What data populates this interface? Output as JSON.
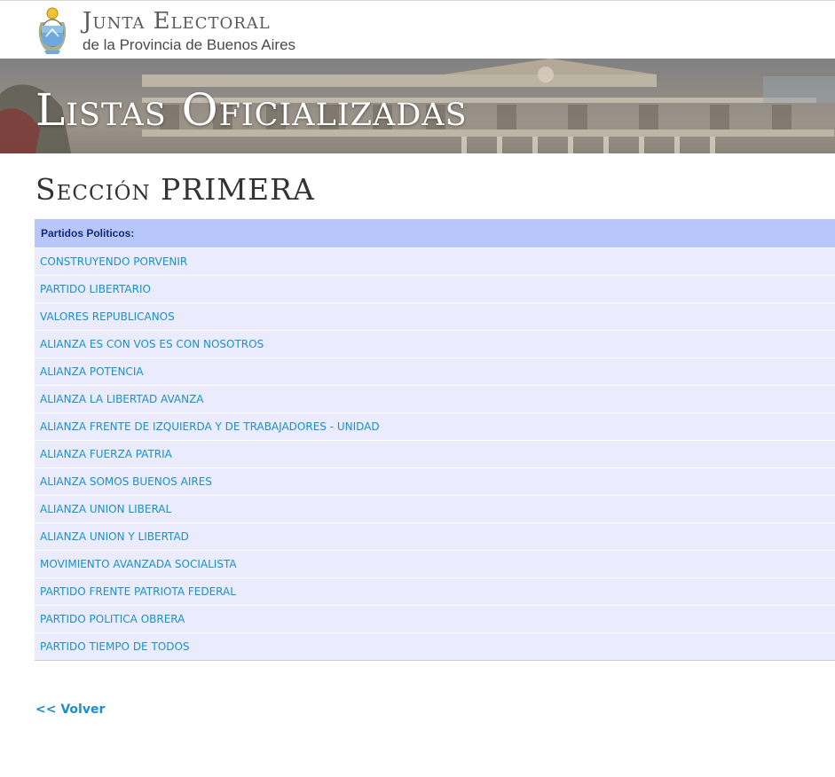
{
  "header": {
    "brand_title": "Junta Electoral",
    "brand_subtitle": "de la Provincia de Buenos Aires"
  },
  "banner": {
    "title": "Listas Oficializadas"
  },
  "section": {
    "title": "Sección PRIMERA"
  },
  "table": {
    "header": "Partidos Politicos:",
    "parties": [
      "CONSTRUYENDO PORVENIR",
      "PARTIDO LIBERTARIO",
      "VALORES REPUBLICANOS",
      "ALIANZA ES CON VOS ES CON NOSOTROS",
      "ALIANZA POTENCIA",
      "ALIANZA LA LIBERTAD AVANZA",
      "ALIANZA FRENTE DE IZQUIERDA Y DE TRABAJADORES - UNIDAD",
      "ALIANZA FUERZA PATRIA",
      "ALIANZA SOMOS BUENOS AIRES",
      "ALIANZA UNION LIBERAL",
      "ALIANZA UNION Y LIBERTAD",
      "MOVIMIENTO AVANZADA SOCIALISTA",
      "PARTIDO FRENTE PATRIOTA FEDERAL",
      "PARTIDO POLITICA OBRERA",
      "PARTIDO TIEMPO DE TODOS"
    ]
  },
  "footer": {
    "back_label": "<< Volver"
  },
  "colors": {
    "link": "#1a8fcf",
    "table_header_bg": "#b8c7fb",
    "row_bg": "#eaecfd"
  }
}
